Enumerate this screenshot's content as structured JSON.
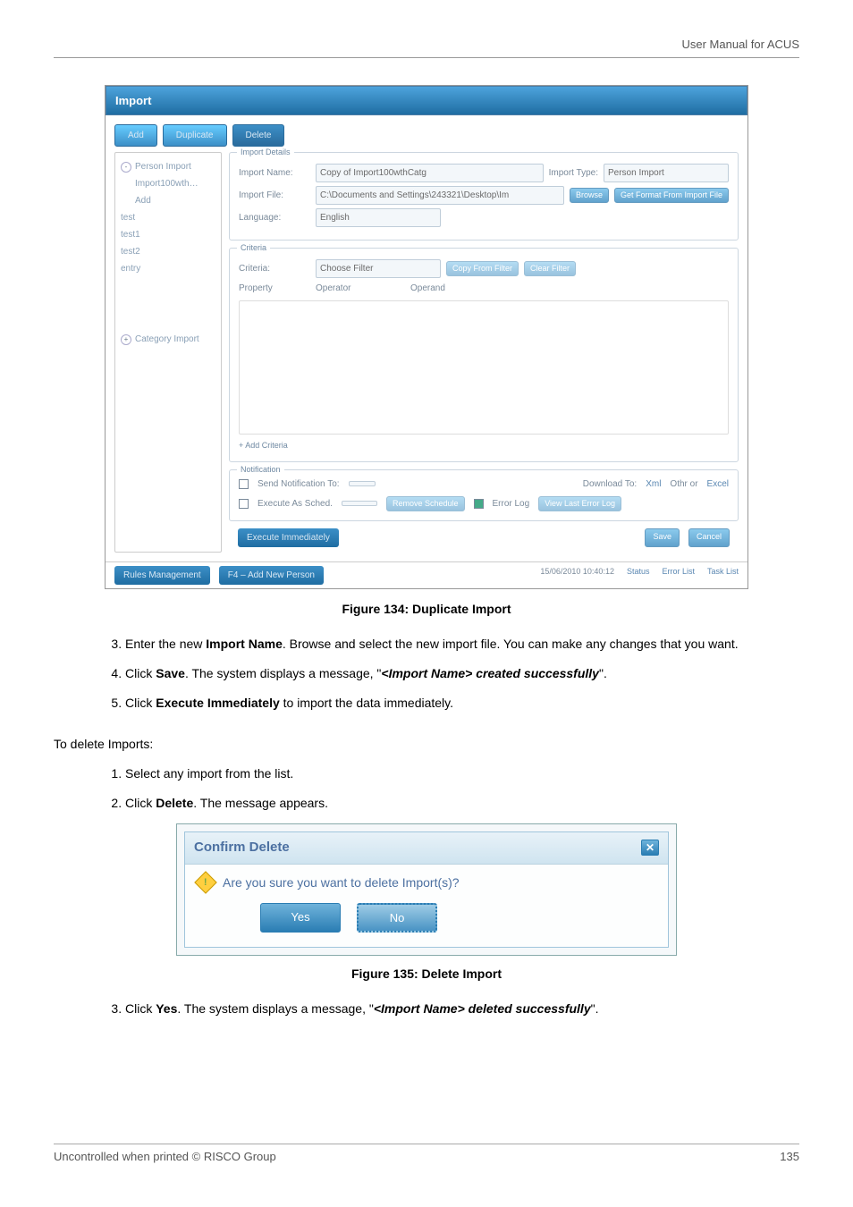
{
  "header": {
    "right": "User Manual for ACUS"
  },
  "figure134": {
    "windowTitle": "Import",
    "tabs": {
      "add": "Add",
      "duplicate": "Duplicate",
      "delete": "Delete"
    },
    "tree": {
      "items": [
        {
          "label": "Person Import",
          "expand": "-"
        },
        {
          "label": "Import100wth…",
          "indent": true
        },
        {
          "label": "Add",
          "indent": true
        },
        {
          "label": "test"
        },
        {
          "label": "test1"
        },
        {
          "label": "test2"
        },
        {
          "label": "entry"
        },
        {
          "label": "Category Import",
          "expand": "+"
        }
      ]
    },
    "details": {
      "groupTitle": "Import Details",
      "nameLabel": "Import Name:",
      "nameValue": "Copy of Import100wthCatg",
      "typeLabel": "Import Type:",
      "typeValue": "Person Import",
      "fileLabel": "Import File:",
      "fileValue": "C:\\Documents and Settings\\243321\\Desktop\\Im",
      "browseBtn": "Browse",
      "formatBtn": "Get Format From Import File",
      "langLabel": "Language:",
      "langValue": "English"
    },
    "criteria": {
      "groupTitle": "Criteria",
      "criteriaLabel": "Criteria:",
      "filterValue": "Choose Filter",
      "copyFromBtn": "Copy From Filter",
      "clearFilterBtn": "Clear Filter",
      "propertyLabel": "Property",
      "operatorLabel": "Operator",
      "operandLabel": "Operand",
      "addCriteria": "+ Add Criteria"
    },
    "notification": {
      "groupTitle": "Notification",
      "sendTo": "Send Notification To:",
      "execSched": "Execute As Sched.",
      "downloadTo": "Download To:",
      "xml": "Xml",
      "other": "Othr or",
      "excel": "Excel",
      "removeSched": "Remove Schedule",
      "errorLog": "Error Log",
      "viewErrLog": "View Last Error Log"
    },
    "execNow": "Execute Immediately",
    "save": "Save",
    "cancel": "Cancel",
    "rulesMgmt": "Rules Management",
    "f4": "F4 – Add New Person",
    "statusDate": "15/06/2010  10:40:12",
    "statusLabel": "Status",
    "errList": "Error List",
    "taskList": "Task List"
  },
  "caption134": "Figure 134: Duplicate Import",
  "steps134": {
    "s3a": "Enter the new ",
    "s3b": "Import Name",
    "s3c": ". Browse and select the new import file. You can make any changes that you want.",
    "s4a": "Click ",
    "s4b": "Save",
    "s4c": ". The system displays a message, \"",
    "s4d": "<Import Name> created successfully",
    "s4e": "\".",
    "s5a": "Click ",
    "s5b": "Execute Immediately",
    "s5c": " to import the data immediately."
  },
  "deleteHead": "To delete Imports:",
  "stepsDeleteA": {
    "s1": "Select any import from the list.",
    "s2a": "Click ",
    "s2b": "Delete",
    "s2c": ". The message appears."
  },
  "confirm": {
    "title": "Confirm Delete",
    "msg": "Are you sure you want to delete Import(s)?",
    "yes": "Yes",
    "no": "No"
  },
  "caption135": "Figure 135: Delete Import",
  "stepsDeleteB": {
    "s3a": "Click ",
    "s3b": "Yes",
    "s3c": ". The system displays a message, \"",
    "s3d": "<Import Name> deleted successfully",
    "s3e": "\"."
  },
  "footer": {
    "left": "Uncontrolled when printed © RISCO Group",
    "right": "135"
  }
}
